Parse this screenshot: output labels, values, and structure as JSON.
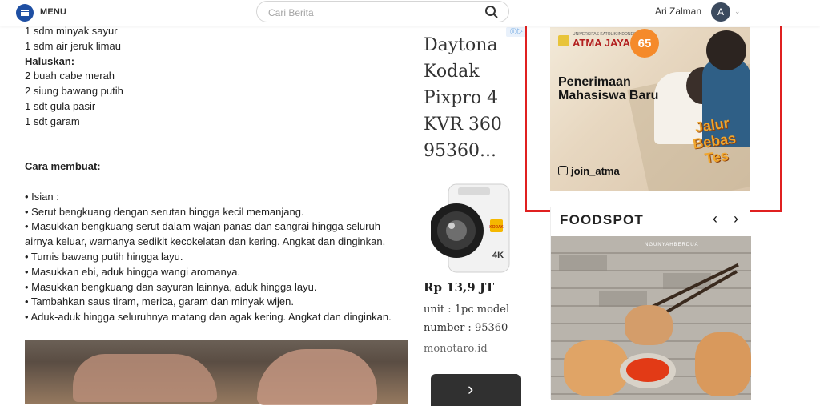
{
  "header": {
    "menu_label": "MENU",
    "search_placeholder": "Cari Berita",
    "user_name": "Ari Zalman",
    "avatar_letter": "A",
    "icons": [
      "menu-icon",
      "search-icon",
      "chevron-down-icon"
    ]
  },
  "article": {
    "lines": [
      {
        "text": "1 sdm minyak sayur",
        "bold": false
      },
      {
        "text": "1 sdm air jeruk limau",
        "bold": false
      },
      {
        "text": "Haluskan:",
        "bold": true
      },
      {
        "text": "2 buah cabe merah",
        "bold": false
      },
      {
        "text": "2 siung bawang putih",
        "bold": false
      },
      {
        "text": "1 sdt gula pasir",
        "bold": false
      },
      {
        "text": "1 sdt garam",
        "bold": false
      },
      {
        "text": "",
        "bold": false
      },
      {
        "text": "",
        "bold": false
      },
      {
        "text": "Cara membuat:",
        "bold": true
      },
      {
        "text": "",
        "bold": false
      },
      {
        "text": "• Isian :",
        "bold": false
      },
      {
        "text": "• Serut bengkuang dengan serutan hingga kecil memanjang.",
        "bold": false
      },
      {
        "text": "• Masukkan bengkuang serut dalam wajan panas dan sangrai hingga seluruh",
        "bold": false
      },
      {
        "text": "airnya keluar, warnanya sedikit kecokelatan dan kering. Angkat dan dinginkan.",
        "bold": false
      },
      {
        "text": "• Tumis bawang putih hingga layu.",
        "bold": false
      },
      {
        "text": "• Masukkan ebi, aduk hingga wangi aromanya.",
        "bold": false
      },
      {
        "text": "• Masukkan bengkuang dan sayuran lainnya, aduk hingga layu.",
        "bold": false
      },
      {
        "text": "• Tambahkan saus tiram, merica, garam dan minyak wijen.",
        "bold": false
      },
      {
        "text": "• Aduk-aduk hingga seluruhnya matang dan agak kering. Angkat dan dinginkan.",
        "bold": false
      }
    ]
  },
  "product_ad": {
    "title": "Daytona Kodak Pixpro 4 KVR 360 95360...",
    "price": "Rp 13,9 JT",
    "description": "unit : 1pc model number : 95360",
    "domain": "monotaro.id",
    "camera_brand": "KODAK",
    "camera_badge": "4K",
    "next_icon": "chevron-right-icon",
    "adchoices_icon": "adchoices-icon"
  },
  "banner_ad": {
    "logo_small": "UNIVERSITAS KATOLIK INDONESIA",
    "logo_text": "ATMA JAYA",
    "anniversary": "65",
    "headline": "Penerimaan Mahasiswa Baru",
    "cta": "Jalur Bebas Tes",
    "instagram": "join_atma"
  },
  "foodspot": {
    "title": "FOODSPOT",
    "prev_icon": "chevron-left-icon",
    "next_icon": "chevron-right-icon",
    "image_brand": "NGUNYAHBERDUA"
  },
  "colors": {
    "accent": "#1e4fa3",
    "highlight": "#e02020",
    "brand_red": "#b21e1e",
    "orange": "#f58a2a"
  }
}
